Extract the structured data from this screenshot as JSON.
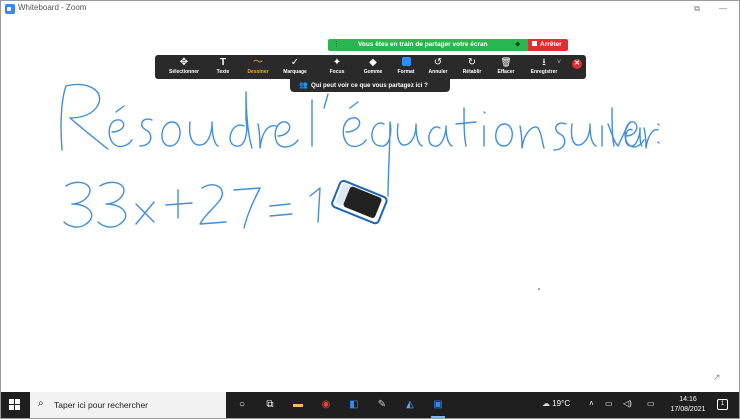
{
  "window": {
    "title": "Whiteboard - Zoom",
    "controls": [
      "⧉",
      "—"
    ]
  },
  "share_banner": {
    "text": "Vous êtes en train de partager votre écran",
    "stop_label": "Arrêter"
  },
  "toolbar": {
    "tools": [
      {
        "label": "Sélectionner",
        "icon": "move-icon",
        "glyph": "✥"
      },
      {
        "label": "Texte",
        "icon": "text-icon",
        "glyph": "T"
      },
      {
        "label": "Dessiner",
        "icon": "draw-icon",
        "glyph": "〜"
      },
      {
        "label": "Marquage",
        "icon": "stamp-icon",
        "glyph": "✓"
      },
      {
        "label": "Focus",
        "icon": "spotlight-icon",
        "glyph": "✦"
      },
      {
        "label": "Gomme",
        "icon": "eraser-icon",
        "glyph": "◆"
      },
      {
        "label": "Format",
        "icon": "format-icon",
        "glyph": ""
      },
      {
        "label": "Annuler",
        "icon": "undo-icon",
        "glyph": "↺"
      },
      {
        "label": "Rétablir",
        "icon": "redo-icon",
        "glyph": "↻"
      },
      {
        "label": "Effacer",
        "icon": "trash-icon",
        "glyph": "🗑"
      },
      {
        "label": "Enregistrer",
        "icon": "save-icon",
        "glyph": "⭳"
      }
    ],
    "active_tool": "Dessiner",
    "close_glyph": "✕",
    "save_dropdown_glyph": "˅"
  },
  "who_can_see": {
    "text": "Qui peut voir ce que vous partagez ici ?"
  },
  "whiteboard": {
    "ink_color": "#3f8fdb"
  },
  "taskbar": {
    "search_placeholder": "Taper ici pour rechercher",
    "weather": "19°C",
    "clock_time": "14:16",
    "clock_date": "17/08/2021",
    "notification_count": "1"
  }
}
